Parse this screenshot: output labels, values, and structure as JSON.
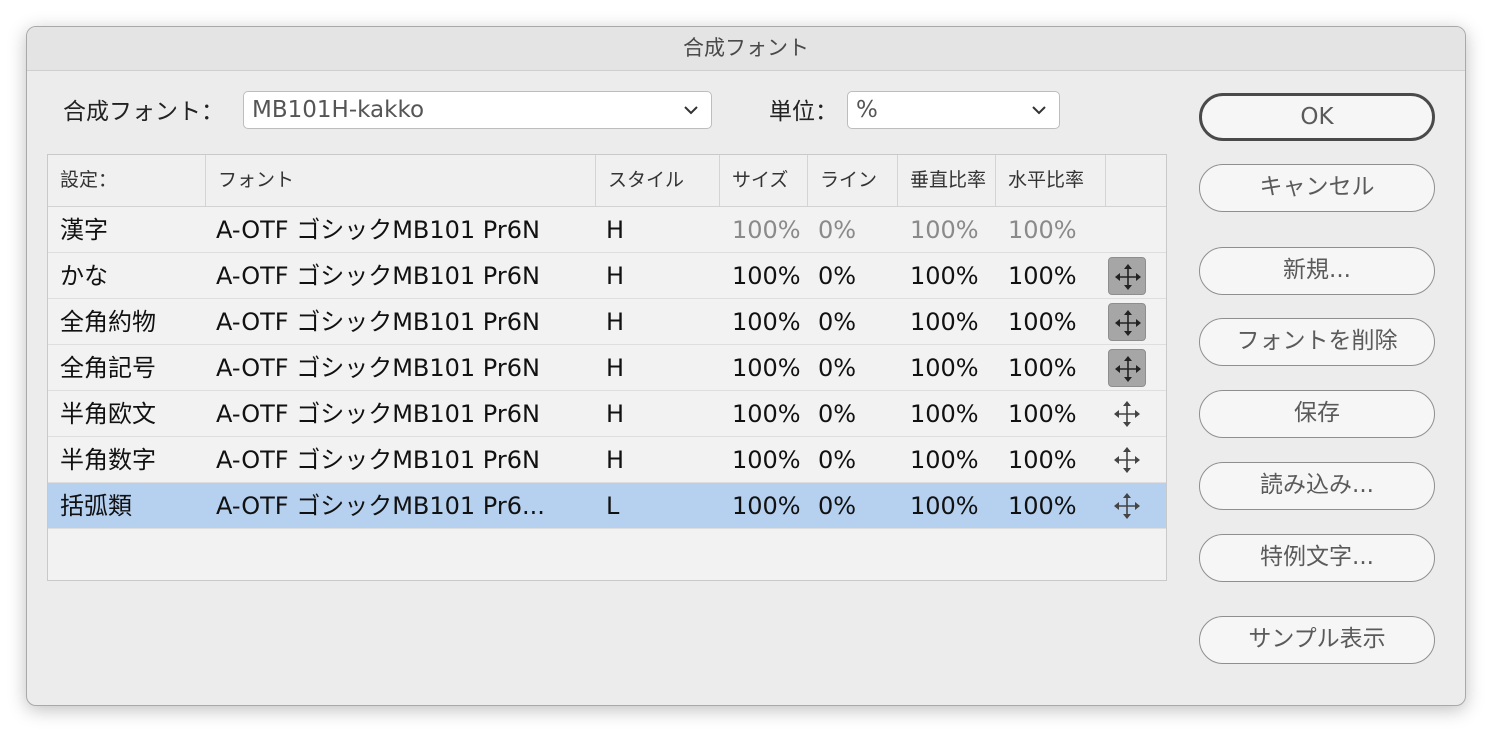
{
  "window": {
    "title": "合成フォント"
  },
  "top": {
    "font_label": "合成フォント：",
    "font_value": "MB101H-kakko",
    "unit_label": "単位：",
    "unit_value": "%"
  },
  "table": {
    "headers": [
      "設定：",
      "フォント",
      "スタイル",
      "サイズ",
      "ライン",
      "垂直比率",
      "水平比率"
    ],
    "rows": [
      {
        "setting": "漢字",
        "font": "A-OTF ゴシックMB101 Pr6N",
        "style": "H",
        "size": "100%",
        "line": "0%",
        "vscale": "100%",
        "hscale": "100%"
      },
      {
        "setting": "かな",
        "font": "A-OTF ゴシックMB101 Pr6N",
        "style": "H",
        "size": "100%",
        "line": "0%",
        "vscale": "100%",
        "hscale": "100%"
      },
      {
        "setting": "全角約物",
        "font": "A-OTF ゴシックMB101 Pr6N",
        "style": "H",
        "size": "100%",
        "line": "0%",
        "vscale": "100%",
        "hscale": "100%"
      },
      {
        "setting": "全角記号",
        "font": "A-OTF ゴシックMB101 Pr6N",
        "style": "H",
        "size": "100%",
        "line": "0%",
        "vscale": "100%",
        "hscale": "100%"
      },
      {
        "setting": "半角欧文",
        "font": "A-OTF ゴシックMB101 Pr6N",
        "style": "H",
        "size": "100%",
        "line": "0%",
        "vscale": "100%",
        "hscale": "100%"
      },
      {
        "setting": "半角数字",
        "font": "A-OTF ゴシックMB101 Pr6N",
        "style": "H",
        "size": "100%",
        "line": "0%",
        "vscale": "100%",
        "hscale": "100%"
      },
      {
        "setting": "括弧類",
        "font": "A-OTF ゴシックMB101 Pr6...",
        "style": "L",
        "size": "100%",
        "line": "0%",
        "vscale": "100%",
        "hscale": "100%"
      }
    ]
  },
  "buttons": {
    "ok": "OK",
    "cancel": "キャンセル",
    "new": "新規...",
    "delete_font": "フォントを削除",
    "save": "保存",
    "load": "読み込み...",
    "exceptions": "特例文字...",
    "sample": "サンプル表示"
  },
  "icons": {
    "move": "move-arrows-icon",
    "chevron": "chevron-down-icon"
  },
  "colors": {
    "selected_row": "#b6d0ef",
    "window_bg": "#ececec"
  }
}
